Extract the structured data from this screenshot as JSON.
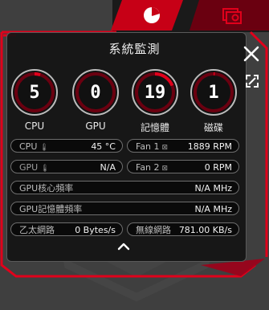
{
  "tabs": [
    {
      "label": "",
      "icon": "pie-chart-icon",
      "active": true
    },
    {
      "label": "",
      "icon": "photos-settings-icon",
      "active": false
    }
  ],
  "panel": {
    "title": "系統監測"
  },
  "gauges": [
    {
      "name": "cpu",
      "value": "5",
      "label": "CPU",
      "level": 0.05
    },
    {
      "name": "gpu",
      "value": "0",
      "label": "GPU",
      "level": 0.0
    },
    {
      "name": "memory",
      "value": "19",
      "label": "記憶體",
      "level": 0.19
    },
    {
      "name": "disk",
      "value": "1",
      "label": "磁碟",
      "level": 0.01
    }
  ],
  "stats": {
    "cpu_temp": {
      "label": "CPU",
      "value": "45 °C"
    },
    "gpu_temp": {
      "label": "GPU",
      "value": "N/A"
    },
    "fan1": {
      "label": "Fan 1",
      "value": "1889 RPM"
    },
    "fan2": {
      "label": "Fan 2",
      "value": "0 RPM"
    },
    "gpu_core_freq": {
      "label": "GPU核心頻率",
      "value": "N/A MHz"
    },
    "gpu_mem_freq": {
      "label": "GPU記憶體頻率",
      "value": "N/A MHz"
    },
    "ethernet": {
      "label": "乙太網路",
      "value": "0 Bytes/s"
    },
    "wireless": {
      "label": "無線網路",
      "value": "781.00 KB/s"
    }
  },
  "colors": {
    "accent": "#e0001b",
    "accent_dark": "#8a0010",
    "panel_bg": "#141414"
  }
}
